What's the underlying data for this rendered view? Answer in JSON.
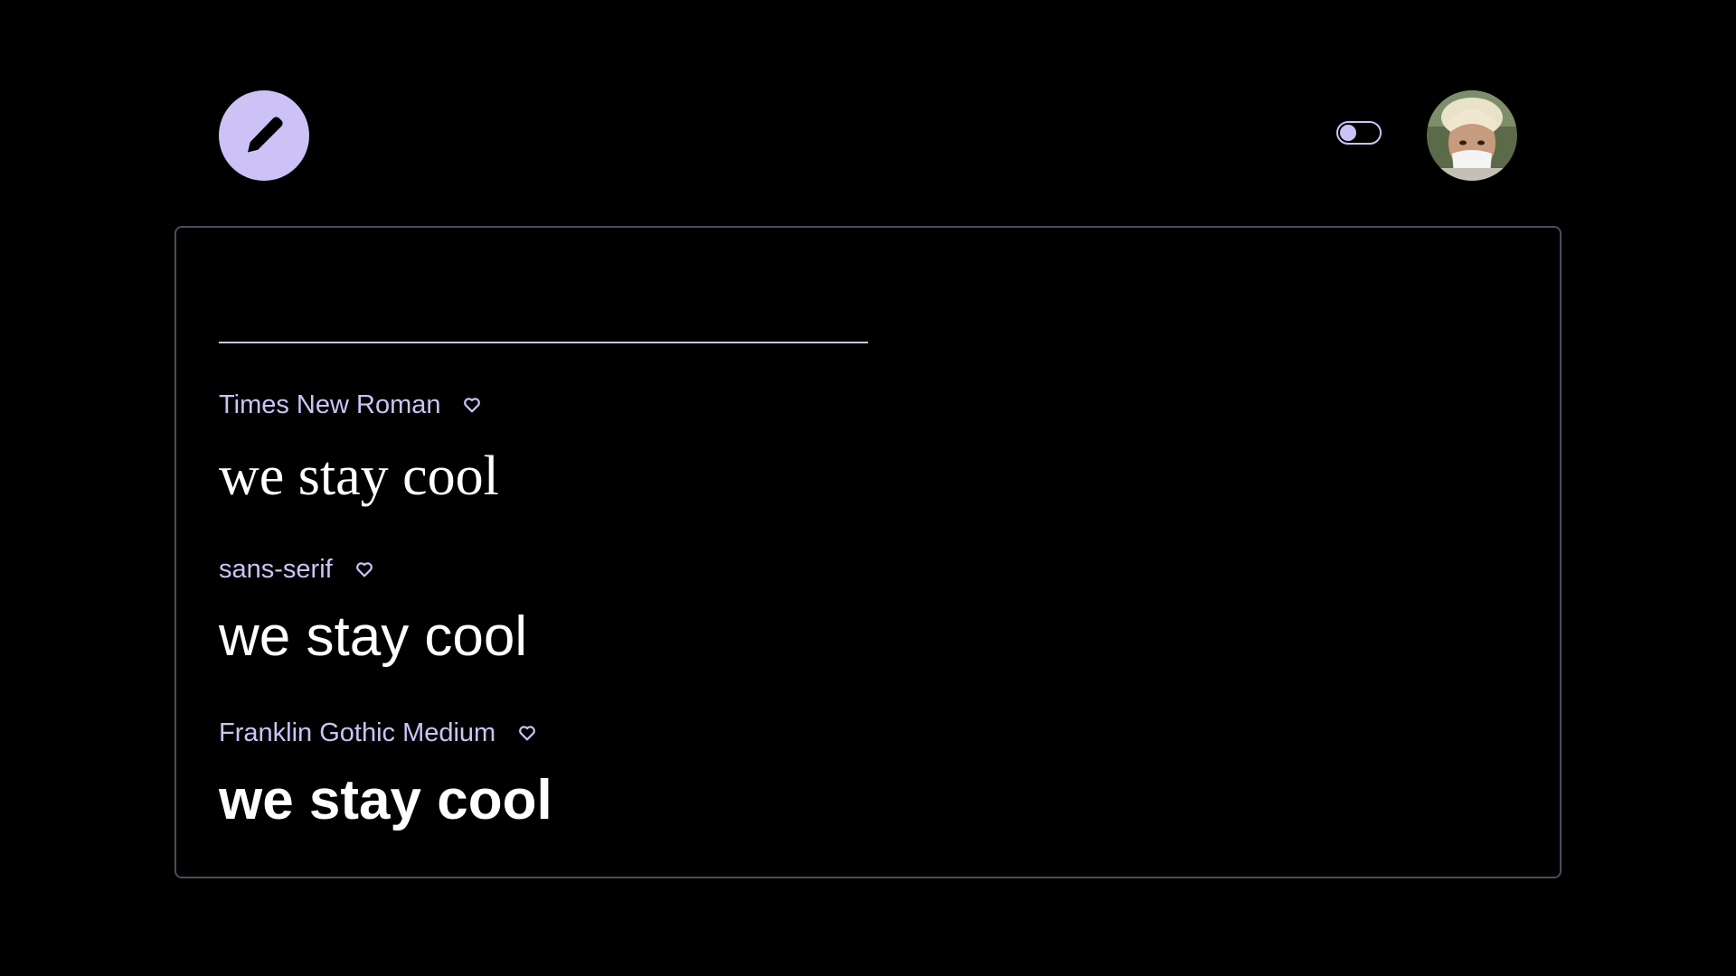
{
  "header": {
    "logo_icon": "pencil-icon",
    "theme_toggle_icon": "toggle-switch",
    "avatar_icon": "user-avatar"
  },
  "search": {
    "value": "",
    "placeholder": ""
  },
  "fonts": [
    {
      "name": "Times New Roman",
      "sample": "we stay cool",
      "favorite_icon": "heart-icon"
    },
    {
      "name": "sans-serif",
      "sample": "we stay cool",
      "favorite_icon": "heart-icon"
    },
    {
      "name": "Franklin Gothic Medium",
      "sample": "we stay cool",
      "favorite_icon": "heart-icon"
    }
  ],
  "colors": {
    "background": "#000000",
    "accent": "#cdc2f5",
    "panel_border": "#4c4c5c",
    "sample_text": "#ffffff"
  }
}
